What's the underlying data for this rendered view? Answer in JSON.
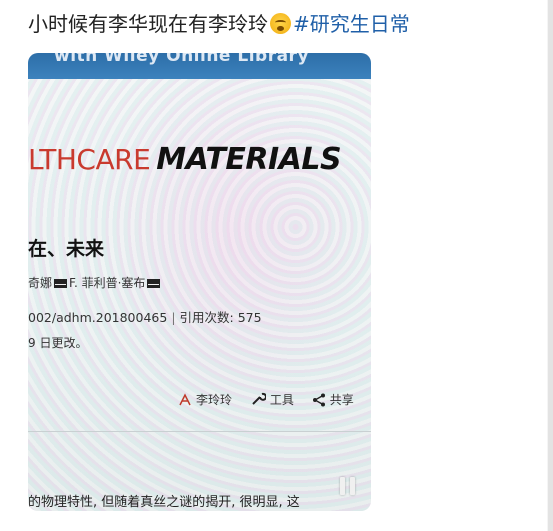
{
  "post": {
    "text_before": "小时候有李华现在有李玲玲",
    "emoji": "yawning-face-emoji",
    "hashtag": "#研究生日常"
  },
  "media": {
    "banner_text": "with Wiley Online Library",
    "journal_prefix": "LTHCARE",
    "journal_suffix": "MATERIALS",
    "heading": "在、未来",
    "authors": {
      "author1": "奇娜",
      "author2": "F. 菲利普·塞布"
    },
    "doi": "002/adhm.201800465",
    "citations_label": "引用次数: 575",
    "updated": "9 日更改。",
    "toolbar": {
      "pdf_label": "李玲玲",
      "tools_label": "工具",
      "share_label": "共享"
    },
    "snippet": "的物理特性, 但随着真丝之谜的揭开, 很明显, 这"
  },
  "colors": {
    "hashtag": "#1f5fa8",
    "journal_accent": "#c93a2e",
    "banner": "#2d6ea8"
  }
}
